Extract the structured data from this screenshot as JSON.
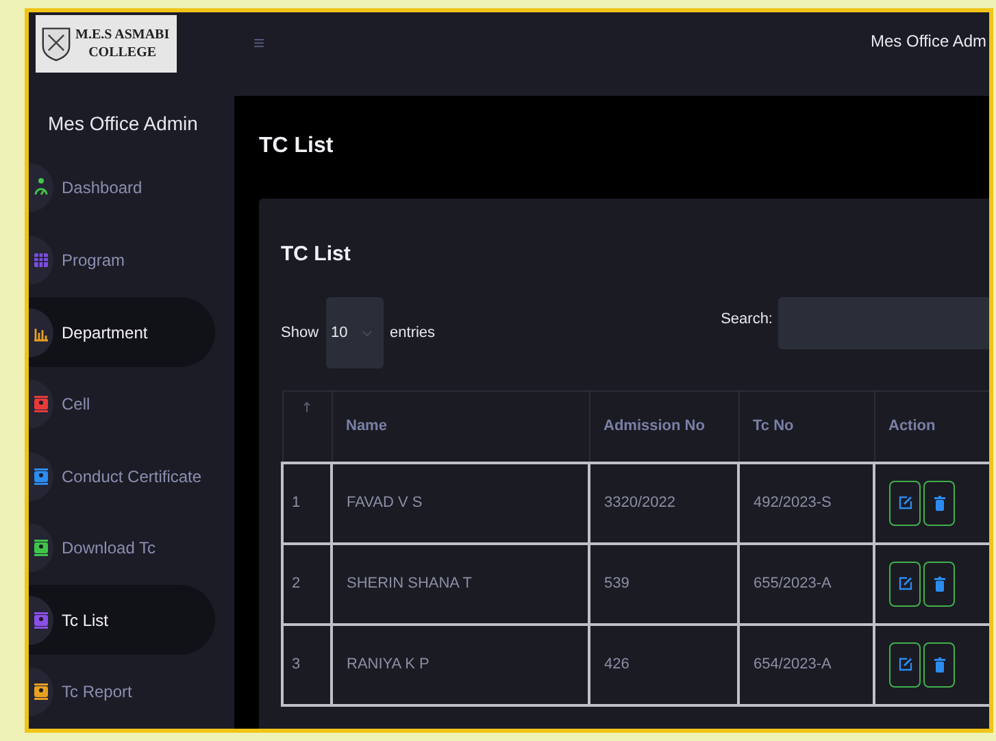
{
  "logo": {
    "lines": [
      "M.E.S ASMABI",
      "COLLEGE"
    ]
  },
  "sidebar": {
    "title": "Mes Office Admin",
    "items": [
      {
        "label": "Dashboard",
        "kind": "gauge",
        "color": "#3fc44a",
        "selected": false
      },
      {
        "label": "Program",
        "kind": "grid",
        "color": "#7a4fe0",
        "selected": false
      },
      {
        "label": "Department",
        "kind": "bars",
        "color": "#e8a020",
        "selected": true
      },
      {
        "label": "Cell",
        "kind": "badge",
        "color": "#e83a3a",
        "selected": false
      },
      {
        "label": "Conduct Certificate",
        "kind": "badge",
        "color": "#2b8cf0",
        "selected": false
      },
      {
        "label": "Download Tc",
        "kind": "badge",
        "color": "#3fc44a",
        "selected": false
      },
      {
        "label": "Tc List",
        "kind": "badge",
        "color": "#8a4fe8",
        "selected": true
      },
      {
        "label": "Tc Report",
        "kind": "badge",
        "color": "#e8a020",
        "selected": false
      }
    ]
  },
  "header": {
    "menu_icon": "≡",
    "user": "Mes Office Adm"
  },
  "page_title": "TC List",
  "card": {
    "title": "TC List",
    "show_label": "Show",
    "entries_value": "10",
    "entries_label": "entries",
    "search_label": "Search:",
    "table": {
      "columns": [
        "Name",
        "Admission No",
        "Tc No",
        "Action"
      ],
      "rows": [
        {
          "index": "1",
          "name": "FAVAD V S",
          "admission_no": "3320/2022",
          "tc_no": "492/2023-S"
        },
        {
          "index": "2",
          "name": "SHERIN SHANA T",
          "admission_no": "539",
          "tc_no": "655/2023-A"
        },
        {
          "index": "3",
          "name": "RANIYA K P",
          "admission_no": "426",
          "tc_no": "654/2023-A"
        }
      ]
    }
  }
}
